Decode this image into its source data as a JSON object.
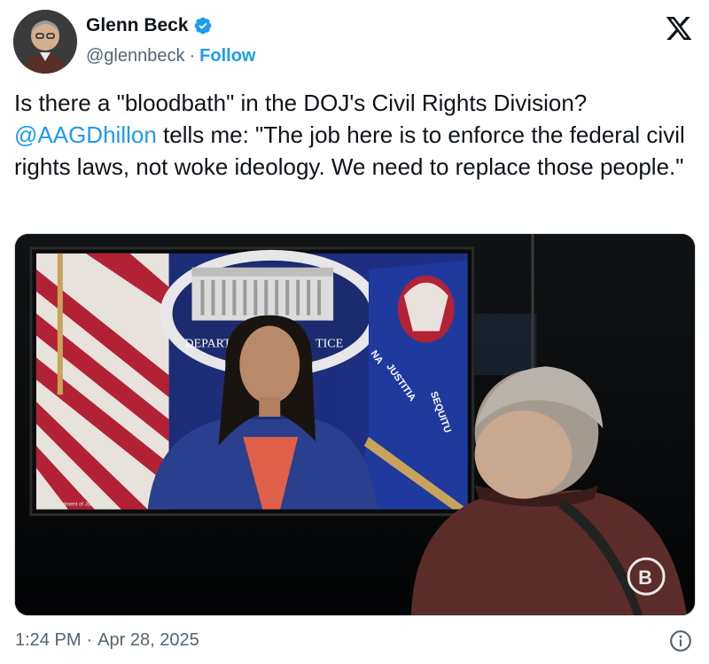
{
  "author": {
    "display_name": "Glenn Beck",
    "handle": "@glennbeck",
    "separator": "·",
    "follow_label": "Follow",
    "verified": true,
    "avatar_icon": "profile-photo"
  },
  "platform": {
    "logo": "x-logo"
  },
  "tweet": {
    "line1": "Is there a \"bloodbath\" in the DOJ's Civil Rights Division?",
    "mention": "@AAGDhillon",
    "line2_rest": " tells me: \"The job here is to enforce the federal civil rights laws, not woke ideology. We need to replace those people.\""
  },
  "media": {
    "screen_seal_text_left": "DEPARTM",
    "screen_seal_text_right": "TICE",
    "flag_text_1": "JUSTITIA",
    "flag_text_2": "SEQUITU",
    "flag_text_3": "NA",
    "screen_caption": "U.S. Department of Justice",
    "watermark_icon": "blaze-logo"
  },
  "footer": {
    "time": "1:24 PM",
    "separator": "·",
    "date": "Apr 28, 2025",
    "info_icon": "info-icon"
  },
  "colors": {
    "link": "#1d9bf0",
    "text": "#0f1419",
    "secondary": "#536471"
  }
}
